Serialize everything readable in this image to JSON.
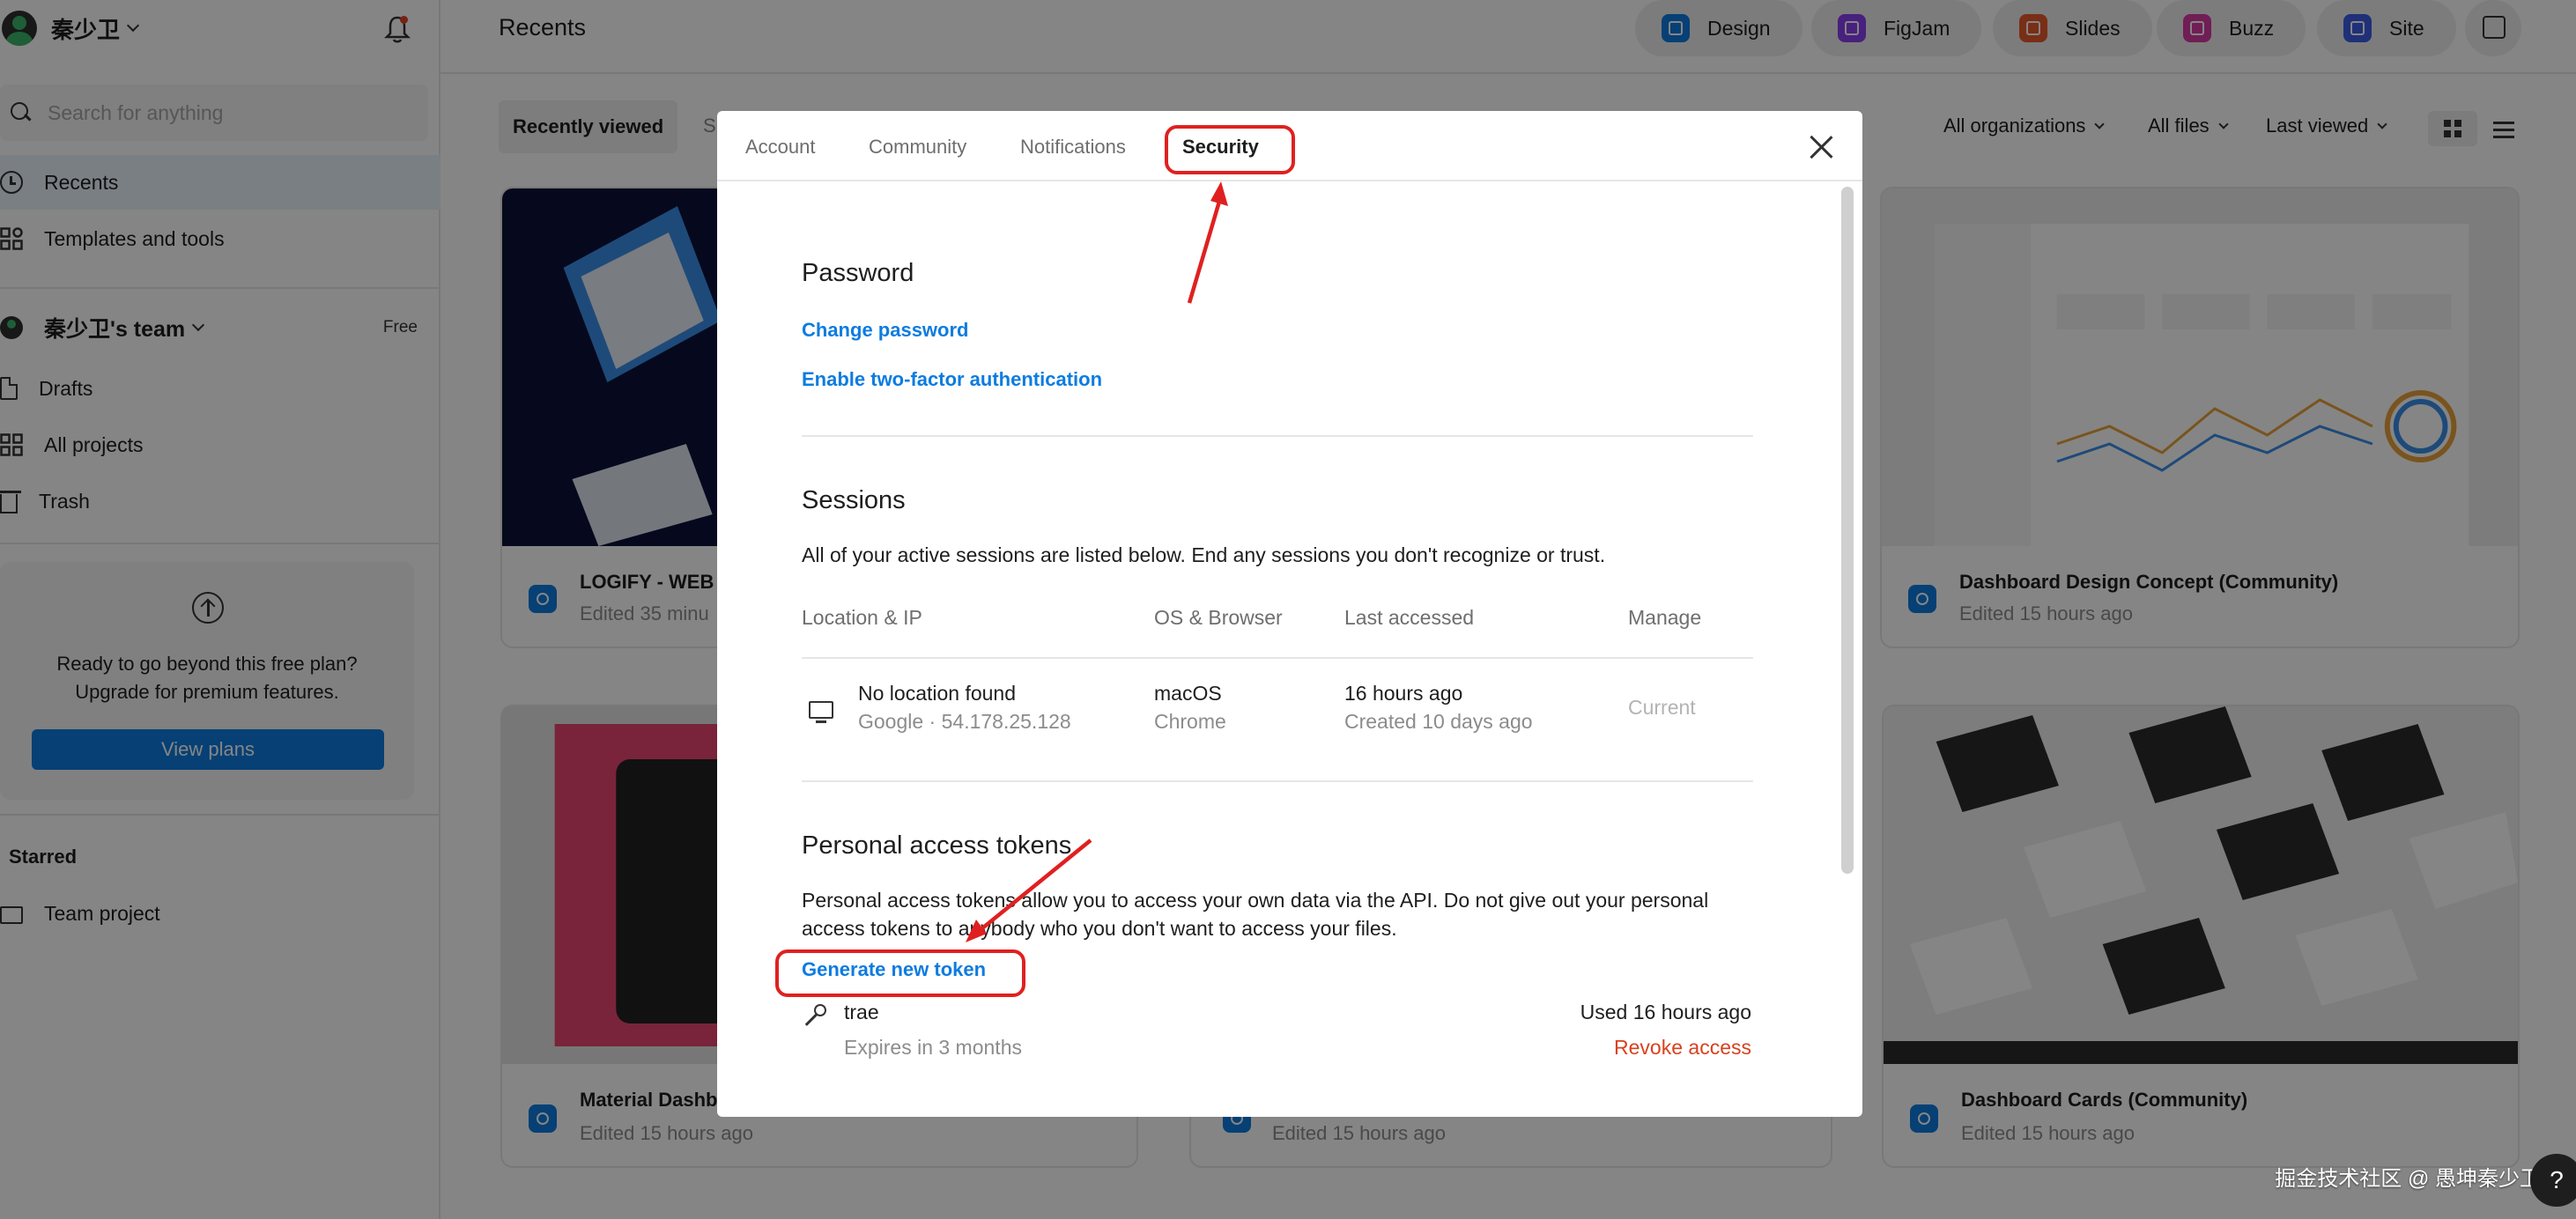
{
  "sidebar": {
    "user_name": "秦少卫",
    "search_placeholder": "Search for anything",
    "nav": {
      "recents": "Recents",
      "templates": "Templates and tools"
    },
    "team": {
      "name": "秦少卫's team",
      "badge": "Free"
    },
    "team_nav": {
      "drafts": "Drafts",
      "all_projects": "All projects",
      "trash": "Trash"
    },
    "upgrade": {
      "line1": "Ready to go beyond this free plan?",
      "line2": "Upgrade for premium features.",
      "button": "View plans"
    },
    "starred": {
      "label": "Starred",
      "item": "Team project"
    }
  },
  "header": {
    "title": "Recents",
    "apps": {
      "design": "Design",
      "figjam": "FigJam",
      "slides": "Slides",
      "buzz": "Buzz",
      "site": "Site"
    }
  },
  "filters": {
    "recently_viewed": "Recently viewed",
    "partial_tab": "S",
    "organizations": "All organizations",
    "files": "All files",
    "sort": "Last viewed"
  },
  "cards": {
    "card1": {
      "title": "LOGIFY - WEB",
      "subtitle": "Edited 35 minu"
    },
    "card2": {
      "title": "Dashboard Design Concept (Community)",
      "subtitle": "Edited 15 hours ago"
    },
    "card3": {
      "title": "Material Dashb",
      "subtitle": "Edited 15 hours ago"
    },
    "card4": {
      "subtitle": "Edited 15 hours ago"
    },
    "card5": {
      "title": "Dashboard Cards (Community)",
      "subtitle": "Edited 15 hours ago"
    }
  },
  "modal": {
    "tabs": {
      "account": "Account",
      "community": "Community",
      "notifications": "Notifications",
      "security": "Security"
    },
    "password": {
      "title": "Password",
      "change": "Change password",
      "two_factor": "Enable two-factor authentication"
    },
    "sessions": {
      "title": "Sessions",
      "description": "All of your active sessions are listed below. End any sessions you don't recognize or trust.",
      "columns": {
        "location": "Location & IP",
        "os": "OS & Browser",
        "last": "Last accessed",
        "manage": "Manage"
      },
      "row": {
        "location": "No location found",
        "ip": "Google · 54.178.25.128",
        "os": "macOS",
        "browser": "Chrome",
        "last": "16 hours ago",
        "created": "Created 10 days ago",
        "manage": "Current"
      }
    },
    "tokens": {
      "title": "Personal access tokens",
      "description": "Personal access tokens allow you to access your own data via the API. Do not give out your personal access tokens to anybody who you don't want to access your files.",
      "generate": "Generate new token",
      "token": {
        "name": "trae",
        "expires": "Expires in 3 months",
        "used": "Used 16 hours ago",
        "revoke": "Revoke access"
      }
    }
  },
  "colors": {
    "accent": "#0d7ce0",
    "danger": "#e5402a",
    "annotation": "#e02020"
  },
  "watermark": "掘金技术社区 @ 愚坤秦少卫",
  "help": "?"
}
